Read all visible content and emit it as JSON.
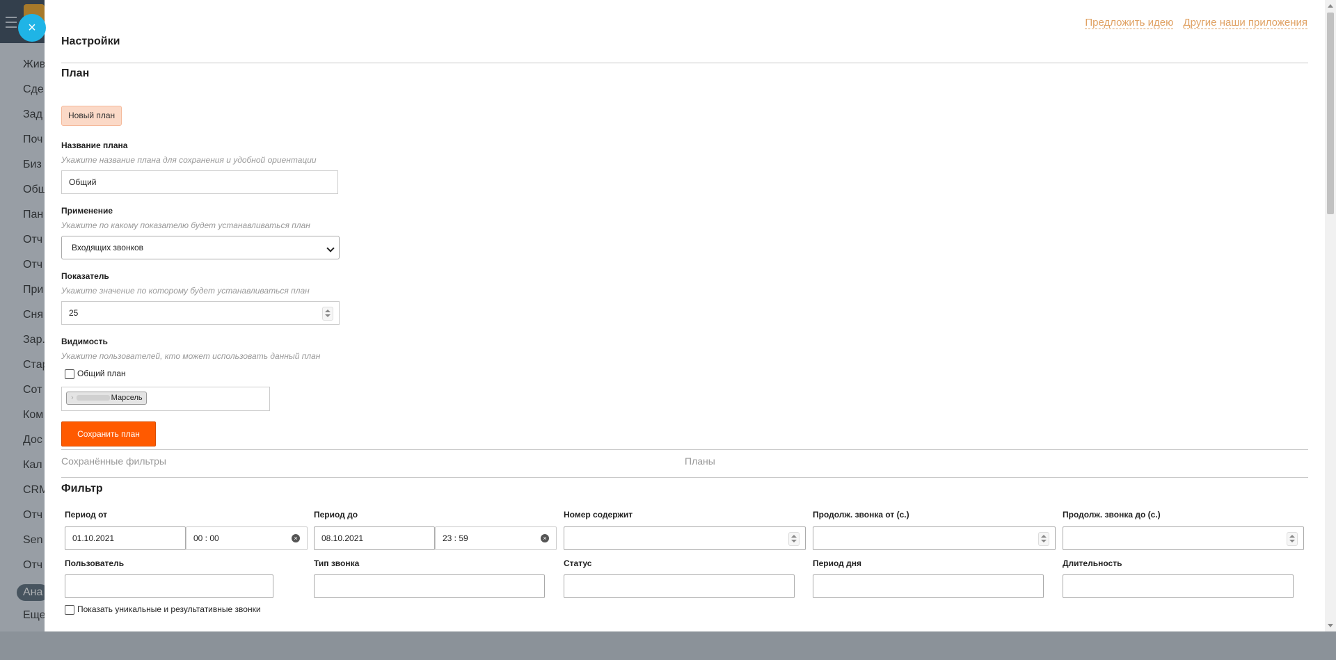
{
  "background_menu": [
    {
      "label": "Жив"
    },
    {
      "label": "Сде"
    },
    {
      "label": "Зад"
    },
    {
      "label": "Поч"
    },
    {
      "label": "Биз"
    },
    {
      "label": "Общ"
    },
    {
      "label": "Пан"
    },
    {
      "label": "Отч"
    },
    {
      "label": "Отч"
    },
    {
      "label": "При"
    },
    {
      "label": "Сня"
    },
    {
      "label": "Зар."
    },
    {
      "label": "Стар"
    },
    {
      "label": "Сот"
    },
    {
      "label": "Ком"
    },
    {
      "label": "Дос"
    },
    {
      "label": "Кал"
    },
    {
      "label": "CRM"
    },
    {
      "label": "Отч"
    },
    {
      "label": "Sen"
    },
    {
      "label": "Отч"
    },
    {
      "label": "Ана"
    },
    {
      "label": "Еще"
    }
  ],
  "panel": {
    "close_glyph": "×",
    "links": {
      "suggest_idea": "Предложить идею",
      "other_apps": "Другие наши приложения"
    },
    "title": "Настройки",
    "plan_section": {
      "heading": "План",
      "new_plan_chip": "Новый план",
      "name": {
        "label": "Название плана",
        "hint": "Укажите название плана для сохранения и удобной ориентации",
        "value": "Общий"
      },
      "application": {
        "label": "Применение",
        "hint": "Укажите по какому показателю будет устанавливаться план",
        "value": "Входящих звонков"
      },
      "indicator": {
        "label": "Показатель",
        "hint": "Укажите значение по которому будет устанавливаться план",
        "value": "25"
      },
      "visibility": {
        "label": "Видимость",
        "hint": "Укажите пользователей, кто может использовать данный план",
        "common_plan": "Общий план",
        "common_plan_checked": false,
        "user_tag": "Марсель"
      },
      "save_button": "Сохранить план"
    },
    "tabs": {
      "saved_filters": "Сохранённые фильтры",
      "plans": "Планы"
    },
    "filter_section": {
      "heading": "Фильтр",
      "period_from": {
        "label": "Период от",
        "date": "01.10.2021",
        "time": "00 : 00"
      },
      "period_to": {
        "label": "Период до",
        "date": "08.10.2021",
        "time": "23 : 59"
      },
      "number_contains": {
        "label": "Номер содержит",
        "value": ""
      },
      "duration_from": {
        "label": "Продолж. звонка от (с.)",
        "value": ""
      },
      "duration_to": {
        "label": "Продолж. звонка до (с.)",
        "value": ""
      },
      "user": {
        "label": "Пользователь",
        "value": ""
      },
      "call_type": {
        "label": "Тип звонка",
        "value": ""
      },
      "status": {
        "label": "Статус",
        "value": ""
      },
      "day_period": {
        "label": "Период дня",
        "value": ""
      },
      "duration": {
        "label": "Длительность",
        "value": ""
      },
      "unique_checkbox": {
        "label": "Показать уникальные и результативные звонки",
        "checked": false
      }
    }
  },
  "colors": {
    "accent_orange": "#ff5a00",
    "link_orange": "#e0a264",
    "close_blue": "#1fb4e6",
    "chip_bg": "#fbd9c7"
  }
}
